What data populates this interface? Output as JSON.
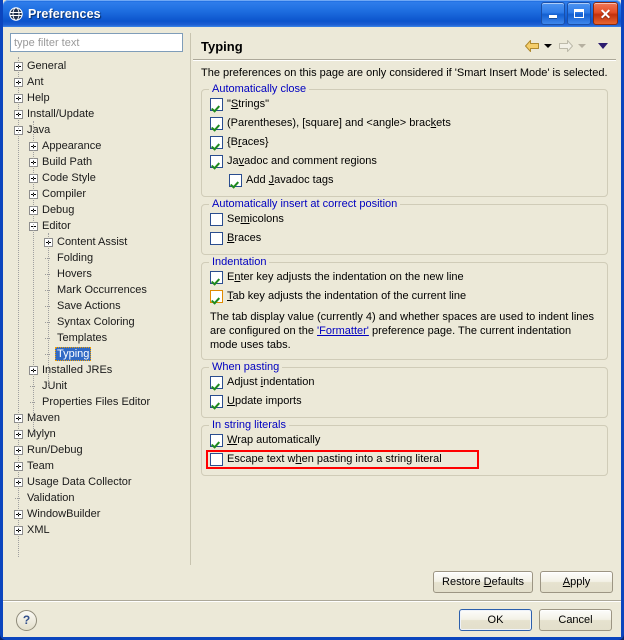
{
  "window": {
    "title": "Preferences",
    "icon": "eclipse-globe-icon",
    "buttons": {
      "minimize": "minimize-button",
      "maximize": "maximize-button",
      "close_glyph": "✕"
    }
  },
  "filter": {
    "placeholder": "type filter text",
    "value": ""
  },
  "tree": {
    "items": [
      {
        "label": "General",
        "depth": 0,
        "state": "plus"
      },
      {
        "label": "Ant",
        "depth": 0,
        "state": "plus"
      },
      {
        "label": "Help",
        "depth": 0,
        "state": "plus"
      },
      {
        "label": "Install/Update",
        "depth": 0,
        "state": "plus"
      },
      {
        "label": "Java",
        "depth": 0,
        "state": "minus"
      },
      {
        "label": "Appearance",
        "depth": 1,
        "state": "plus"
      },
      {
        "label": "Build Path",
        "depth": 1,
        "state": "plus"
      },
      {
        "label": "Code Style",
        "depth": 1,
        "state": "plus"
      },
      {
        "label": "Compiler",
        "depth": 1,
        "state": "plus"
      },
      {
        "label": "Debug",
        "depth": 1,
        "state": "plus"
      },
      {
        "label": "Editor",
        "depth": 1,
        "state": "minus"
      },
      {
        "label": "Content Assist",
        "depth": 2,
        "state": "plus"
      },
      {
        "label": "Folding",
        "depth": 2,
        "state": "leaf"
      },
      {
        "label": "Hovers",
        "depth": 2,
        "state": "leaf"
      },
      {
        "label": "Mark Occurrences",
        "depth": 2,
        "state": "leaf"
      },
      {
        "label": "Save Actions",
        "depth": 2,
        "state": "leaf"
      },
      {
        "label": "Syntax Coloring",
        "depth": 2,
        "state": "leaf"
      },
      {
        "label": "Templates",
        "depth": 2,
        "state": "leaf"
      },
      {
        "label": "Typing",
        "depth": 2,
        "state": "leaf",
        "selected": true
      },
      {
        "label": "Installed JREs",
        "depth": 1,
        "state": "plus"
      },
      {
        "label": "JUnit",
        "depth": 1,
        "state": "leaf"
      },
      {
        "label": "Properties Files Editor",
        "depth": 1,
        "state": "leaf"
      },
      {
        "label": "Maven",
        "depth": 0,
        "state": "plus"
      },
      {
        "label": "Mylyn",
        "depth": 0,
        "state": "plus"
      },
      {
        "label": "Run/Debug",
        "depth": 0,
        "state": "plus"
      },
      {
        "label": "Team",
        "depth": 0,
        "state": "plus"
      },
      {
        "label": "Usage Data Collector",
        "depth": 0,
        "state": "plus"
      },
      {
        "label": "Validation",
        "depth": 0,
        "state": "leaf"
      },
      {
        "label": "WindowBuilder",
        "depth": 0,
        "state": "plus"
      },
      {
        "label": "XML",
        "depth": 0,
        "state": "plus"
      }
    ]
  },
  "page": {
    "title": "Typing",
    "nav": {
      "back": "back-arrow-icon",
      "back_menu": "back-dropdown-icon",
      "forward": "forward-arrow-icon",
      "forward_menu": "forward-dropdown-icon",
      "menu": "view-menu-icon"
    },
    "intro": "The preferences on this page are only considered if 'Smart Insert Mode' is selected.",
    "groups": [
      {
        "title": "Automatically close",
        "rows": [
          {
            "pre": "\"",
            "mnemonic": "S",
            "post": "trings\"",
            "checked": true,
            "indent": false,
            "name": "auto-close-strings"
          },
          {
            "pre": "(Parentheses), [square] and <angle> brac",
            "mnemonic": "k",
            "post": "ets",
            "checked": true,
            "indent": false,
            "name": "auto-close-brackets"
          },
          {
            "pre": "{B",
            "mnemonic": "r",
            "post": "aces}",
            "checked": true,
            "indent": false,
            "name": "auto-close-braces"
          },
          {
            "pre": "Ja",
            "mnemonic": "v",
            "post": "adoc and comment regions",
            "checked": true,
            "indent": false,
            "name": "auto-close-javadoc"
          },
          {
            "pre": "Add ",
            "mnemonic": "J",
            "post": "avadoc tags",
            "checked": true,
            "indent": true,
            "name": "add-javadoc-tags"
          }
        ]
      },
      {
        "title": "Automatically insert at correct position",
        "rows": [
          {
            "pre": "Se",
            "mnemonic": "m",
            "post": "icolons",
            "checked": false,
            "indent": false,
            "name": "auto-insert-semicolons"
          },
          {
            "pre": "",
            "mnemonic": "B",
            "post": "races",
            "checked": false,
            "indent": false,
            "name": "auto-insert-braces"
          }
        ]
      },
      {
        "title": "Indentation",
        "rows": [
          {
            "pre": "E",
            "mnemonic": "n",
            "post": "ter key adjusts the indentation on the new line",
            "checked": true,
            "indent": false,
            "name": "enter-key-adjusts-indentation"
          },
          {
            "pre": "",
            "mnemonic": "T",
            "post": "ab key adjusts the indentation of the current line",
            "checked": true,
            "indent": false,
            "focus": true,
            "name": "tab-key-adjusts-indentation"
          }
        ],
        "note": {
          "before": "The tab display value (currently 4) and whether spaces are used to indent lines are configured on the ",
          "link": "'Formatter'",
          "after": " preference page. The current indentation mode uses tabs."
        }
      },
      {
        "title": "When pasting",
        "rows": [
          {
            "pre": "Adjust ",
            "mnemonic": "i",
            "post": "ndentation",
            "checked": true,
            "indent": false,
            "name": "paste-adjust-indentation"
          },
          {
            "pre": "",
            "mnemonic": "U",
            "post": "pdate imports",
            "checked": true,
            "indent": false,
            "name": "paste-update-imports"
          }
        ]
      },
      {
        "title": "In string literals",
        "rows": [
          {
            "pre": "",
            "mnemonic": "W",
            "post": "rap automatically",
            "checked": true,
            "indent": false,
            "name": "wrap-automatically"
          },
          {
            "pre": "Escape text w",
            "mnemonic": "h",
            "post": "en pasting into a string literal",
            "checked": false,
            "indent": false,
            "annotated": true,
            "name": "escape-text-on-paste"
          }
        ]
      }
    ]
  },
  "footer": {
    "restore_defaults": "Restore Defaults",
    "restore_defaults_mnemonic": "D",
    "apply": "Apply",
    "apply_mnemonic": "A",
    "ok": "OK",
    "cancel": "Cancel",
    "help": "?"
  },
  "colors": {
    "dialog_bg": "#ECE9D8",
    "title_blue": "#0B45BE",
    "group_label": "#0000C0",
    "selection": "#316AC5",
    "annotation_red": "#FF0000",
    "check_green": "#1E8A1E",
    "link": "#0000C0"
  }
}
